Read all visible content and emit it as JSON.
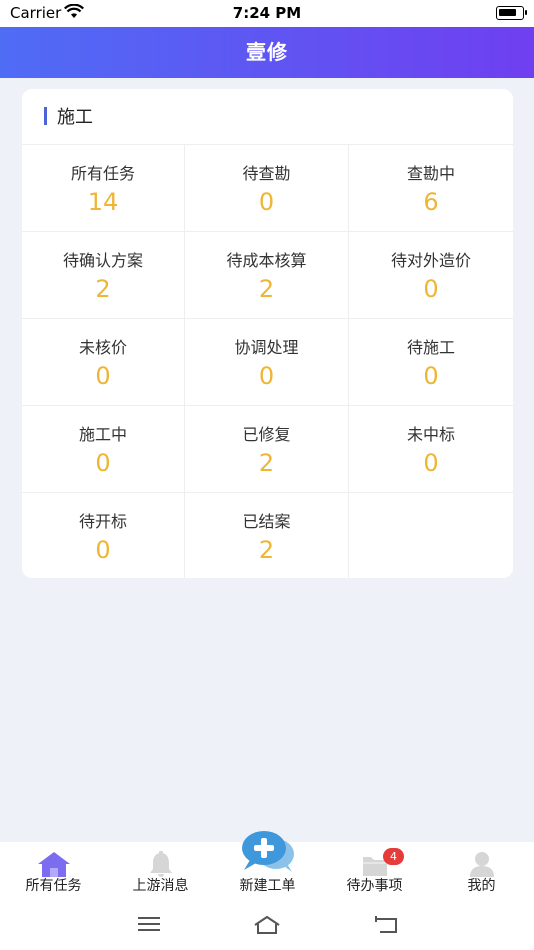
{
  "status": {
    "carrier": "Carrier",
    "time": "7:24 PM"
  },
  "header": {
    "title": "壹修"
  },
  "section": {
    "title": "施工"
  },
  "cells": [
    {
      "label": "所有任务",
      "value": "14"
    },
    {
      "label": "待查勘",
      "value": "0"
    },
    {
      "label": "查勘中",
      "value": "6"
    },
    {
      "label": "待确认方案",
      "value": "2"
    },
    {
      "label": "待成本核算",
      "value": "2"
    },
    {
      "label": "待对外造价",
      "value": "0"
    },
    {
      "label": "未核价",
      "value": "0"
    },
    {
      "label": "协调处理",
      "value": "0"
    },
    {
      "label": "待施工",
      "value": "0"
    },
    {
      "label": "施工中",
      "value": "0"
    },
    {
      "label": "已修复",
      "value": "2"
    },
    {
      "label": "未中标",
      "value": "0"
    },
    {
      "label": "待开标",
      "value": "0"
    },
    {
      "label": "已结案",
      "value": "2"
    }
  ],
  "tabs": [
    {
      "label": "所有任务",
      "icon": "home-icon"
    },
    {
      "label": "上游消息",
      "icon": "bell-icon"
    },
    {
      "label": "新建工单",
      "icon": "chat-plus-icon"
    },
    {
      "label": "待办事项",
      "icon": "folder-icon",
      "badge": "4"
    },
    {
      "label": "我的",
      "icon": "user-icon"
    }
  ],
  "colors": {
    "accent_start": "#4f6cf5",
    "accent_end": "#6f3ff0",
    "value": "#efb535",
    "badge": "#e43b3b",
    "active_tab": "#7b6cf0"
  }
}
